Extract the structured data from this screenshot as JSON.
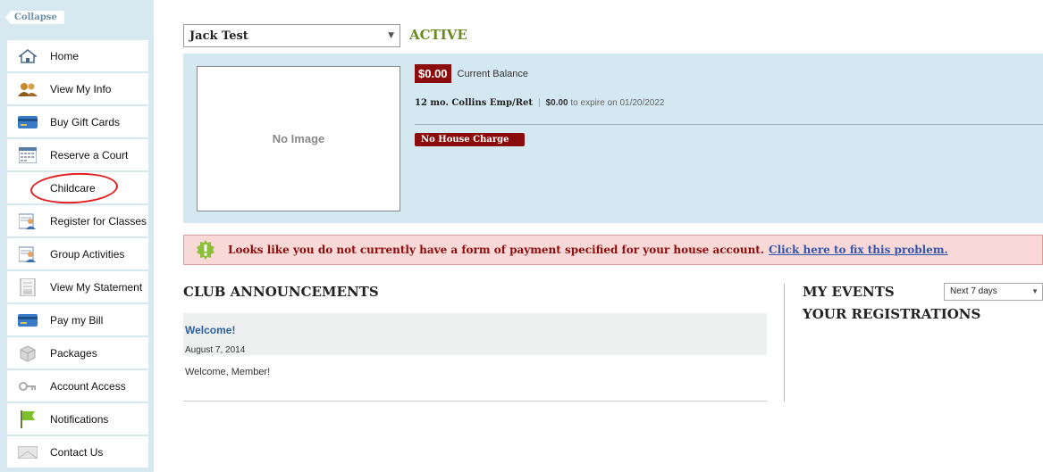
{
  "sidebar": {
    "collapse_label": "Collapse",
    "items": [
      {
        "label": "Home",
        "icon": "home-icon"
      },
      {
        "label": "View My Info",
        "icon": "people-icon"
      },
      {
        "label": "Buy Gift Cards",
        "icon": "credit-card-icon"
      },
      {
        "label": "Reserve a Court",
        "icon": "calendar-icon"
      },
      {
        "label": "Childcare",
        "icon": ""
      },
      {
        "label": "Register for Classes",
        "icon": "class-register-icon"
      },
      {
        "label": "Group Activities",
        "icon": "group-activity-icon"
      },
      {
        "label": "View My Statement",
        "icon": "statement-icon"
      },
      {
        "label": "Pay my Bill",
        "icon": "credit-card-icon"
      },
      {
        "label": "Packages",
        "icon": "package-icon"
      },
      {
        "label": "Account Access",
        "icon": "key-icon"
      },
      {
        "label": "Notifications",
        "icon": "flag-icon"
      },
      {
        "label": "Contact Us",
        "icon": "envelope-icon"
      }
    ]
  },
  "member": {
    "selected_name": "Jack Test",
    "status": "ACTIVE"
  },
  "profile": {
    "photo_placeholder": "No Image",
    "balance_amount": "$0.00",
    "balance_label": "Current Balance",
    "membership_plan": "12 mo. Collins Emp/Ret",
    "membership_separator": "|",
    "membership_amount": "$0.00",
    "membership_expiry": "to expire on 01/20/2022",
    "house_charge_label": "No House Charge"
  },
  "alert": {
    "message": "Looks like you do not currently have a form of payment specified for your house account.",
    "link_text": "Click here to fix this problem."
  },
  "announcements": {
    "heading": "CLUB ANNOUNCEMENTS",
    "items": [
      {
        "title": "Welcome!",
        "date": "August 7, 2014",
        "body": "Welcome, Member!"
      }
    ]
  },
  "events": {
    "heading": "MY EVENTS",
    "range_selected": "Next 7 days",
    "registrations_heading": "YOUR REGISTRATIONS"
  },
  "colors": {
    "sidebar_bg": "#d6e8f0",
    "panel_bg": "#d3e8f0",
    "accent_red": "#8b0c0c",
    "active_green": "#6a8a20",
    "link_blue": "#3355aa",
    "annotation_red": "#e02020"
  }
}
